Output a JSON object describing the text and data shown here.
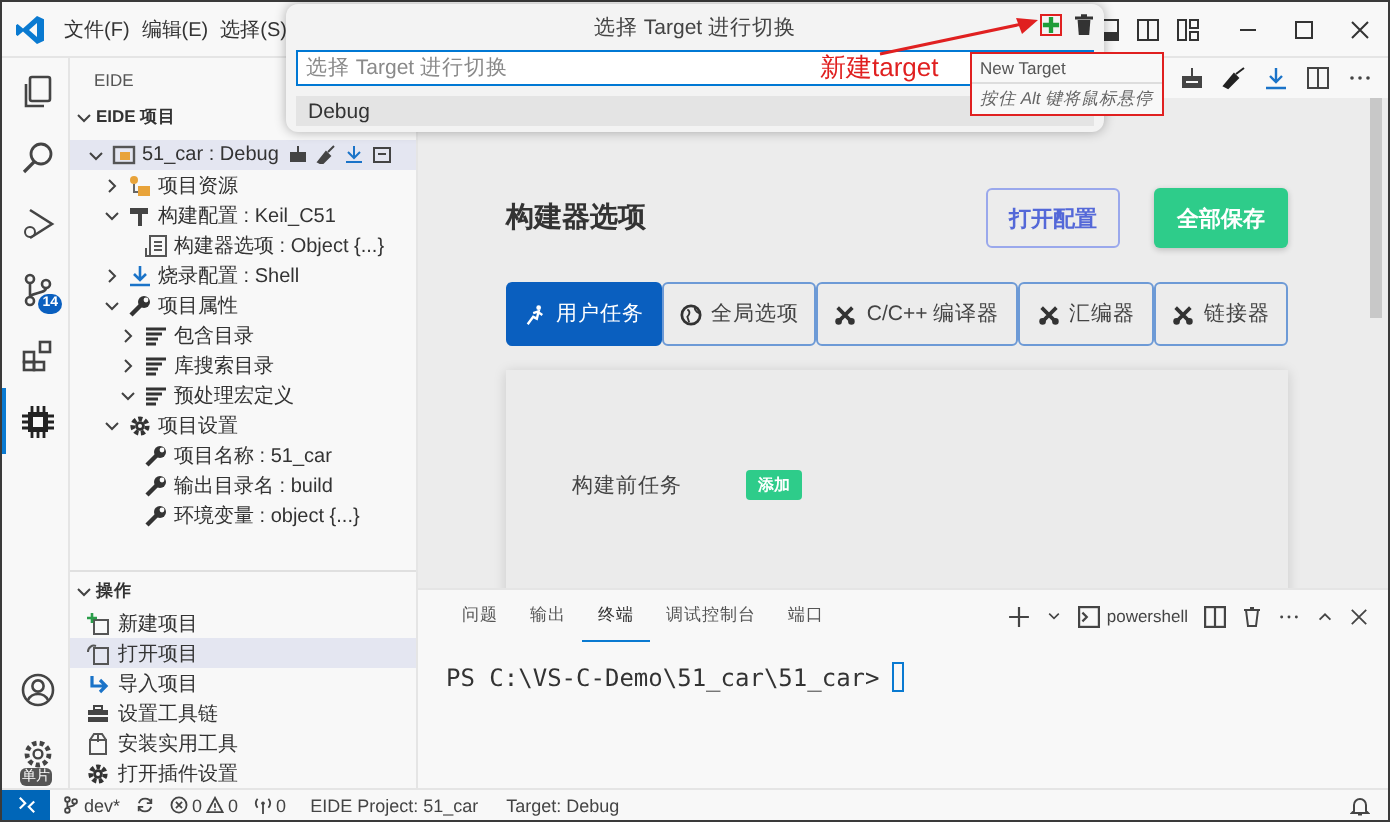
{
  "title_bar": {
    "menus": [
      "文件(F)",
      "编辑(E)",
      "选择(S)"
    ]
  },
  "quick_pick": {
    "title": "选择 Target 进行切换",
    "placeholder": "选择 Target 进行切换",
    "items": [
      {
        "label": "Debug",
        "selected": true
      }
    ]
  },
  "annotation": {
    "label": "新建target"
  },
  "tooltip": {
    "title": "New Target",
    "hint": "按住 Alt 键将鼠标悬停"
  },
  "activity_bar": {
    "items": [
      {
        "kind": "files",
        "selected": false
      },
      {
        "kind": "search",
        "selected": false
      },
      {
        "kind": "debug",
        "selected": false
      },
      {
        "kind": "source-control",
        "selected": false,
        "badge": "14"
      },
      {
        "kind": "extensions",
        "selected": false
      },
      {
        "kind": "chip",
        "selected": true
      }
    ],
    "bottom": [
      {
        "kind": "account"
      },
      {
        "kind": "settings",
        "badge": "单片"
      }
    ]
  },
  "sidebar": {
    "title": "EIDE",
    "project_section": {
      "title": "EIDE 项目",
      "expanded": true,
      "tree": [
        {
          "label": "51_car : Debug",
          "kind": "project",
          "expanded": true,
          "selected": true,
          "children": [
            {
              "label": "项目资源",
              "kind": "resources",
              "expanded": false,
              "selected": false
            },
            {
              "label": "构建配置 : Keil_C51",
              "kind": "builder",
              "expanded": true,
              "selected": false,
              "children": [
                {
                  "label": "构建器选项 : Object {...}",
                  "kind": "options",
                  "selected": false
                }
              ]
            },
            {
              "label": "烧录配置 : Shell",
              "kind": "flash",
              "expanded": false,
              "selected": false
            },
            {
              "label": "项目属性",
              "kind": "wrench",
              "expanded": true,
              "selected": false,
              "children": [
                {
                  "label": "包含目录",
                  "kind": "lines",
                  "expanded": false,
                  "selected": false
                },
                {
                  "label": "库搜索目录",
                  "kind": "lines",
                  "expanded": false,
                  "selected": false
                },
                {
                  "label": "预处理宏定义",
                  "kind": "lines",
                  "expanded": true,
                  "selected": false
                }
              ]
            },
            {
              "label": "项目设置",
              "kind": "gear",
              "expanded": true,
              "selected": false,
              "children": [
                {
                  "label": "项目名称 : 51_car",
                  "kind": "wrench",
                  "selected": false
                },
                {
                  "label": "输出目录名 : build",
                  "kind": "wrench",
                  "selected": false
                },
                {
                  "label": "环境变量 : object {...}",
                  "kind": "wrench",
                  "selected": false
                }
              ]
            }
          ]
        }
      ]
    },
    "actions_section": {
      "title": "操作",
      "expanded": true,
      "items": [
        {
          "label": "新建项目",
          "kind": "new",
          "selected": false
        },
        {
          "label": "打开项目",
          "kind": "open",
          "selected": true
        },
        {
          "label": "导入项目",
          "kind": "import",
          "selected": false
        },
        {
          "label": "设置工具链",
          "kind": "toolbox",
          "selected": false
        },
        {
          "label": "安装实用工具",
          "kind": "package",
          "selected": false
        },
        {
          "label": "打开插件设置",
          "kind": "gear",
          "selected": false
        }
      ]
    }
  },
  "editor": {
    "heading": "构建器选项",
    "buttons": [
      {
        "label": "打开配置",
        "kind": "outline"
      },
      {
        "label": "全部保存",
        "kind": "primary"
      }
    ],
    "tabs": [
      {
        "label": "用户任务",
        "kind": "run",
        "selected": true
      },
      {
        "label": "全局选项",
        "kind": "globe",
        "selected": false
      },
      {
        "label": "C/C++ 编译器",
        "kind": "tools",
        "selected": false
      },
      {
        "label": "汇编器",
        "kind": "tools",
        "selected": false
      },
      {
        "label": "链接器",
        "kind": "tools",
        "selected": false
      }
    ],
    "card": {
      "rows": [
        {
          "label": "构建前任务",
          "button": "添加"
        }
      ]
    }
  },
  "panel": {
    "tabs": [
      {
        "label": "问题",
        "selected": false
      },
      {
        "label": "输出",
        "selected": false
      },
      {
        "label": "终端",
        "selected": true
      },
      {
        "label": "调试控制台",
        "selected": false
      },
      {
        "label": "端口",
        "selected": false
      }
    ],
    "terminal_profile": "powershell",
    "terminal_lines": [
      "PS C:\\VS-C-Demo\\51_car\\51_car>"
    ]
  },
  "status_bar": {
    "branch": "dev*",
    "errors": "0",
    "warnings": "0",
    "ports": "0",
    "items": [
      "EIDE Project: 51_car",
      "Target: Debug"
    ]
  }
}
